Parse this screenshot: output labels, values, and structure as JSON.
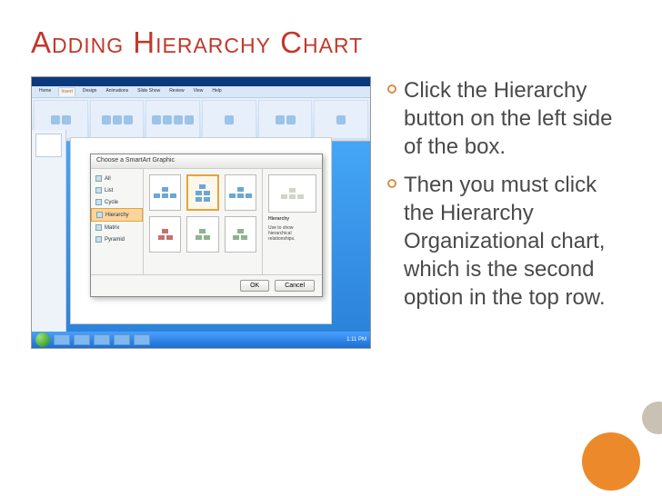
{
  "title": "Adding Hierarchy Chart",
  "bullets": [
    "Click the Hierarchy button on the left side of the box.",
    "Then you must click the Hierarchy Organizational chart, which is the second option in the top row."
  ],
  "screenshot": {
    "ribbon_tabs": [
      "Home",
      "Insert",
      "Design",
      "Animations",
      "Slide Show",
      "Review",
      "View",
      "Help"
    ],
    "active_tab": "Insert",
    "dialog_title": "Choose a SmartArt Graphic",
    "categories": [
      "All",
      "List",
      "Cycle",
      "Hierarchy",
      "Matrix",
      "Pyramid"
    ],
    "selected_category": "Hierarchy",
    "preview_name": "Hierarchy",
    "preview_desc": "Use to show hierarchical relationships.",
    "ok_label": "OK",
    "cancel_label": "Cancel",
    "clock": "1:11 PM"
  }
}
